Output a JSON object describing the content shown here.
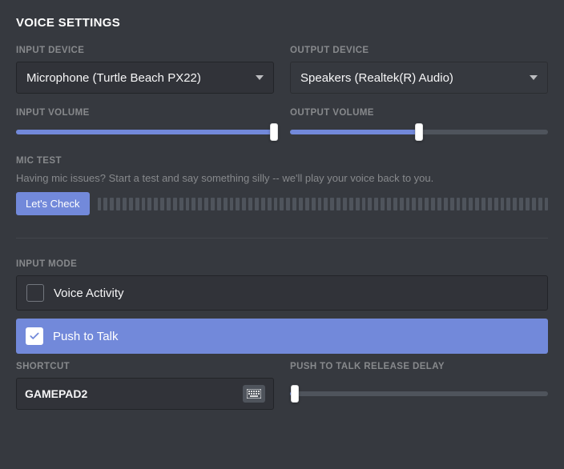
{
  "title": "VOICE SETTINGS",
  "input_device": {
    "label": "INPUT DEVICE",
    "value": "Microphone (Turtle Beach PX22)"
  },
  "output_device": {
    "label": "OUTPUT DEVICE",
    "value": "Speakers (Realtek(R) Audio)"
  },
  "input_volume": {
    "label": "INPUT VOLUME",
    "percent": 100
  },
  "output_volume": {
    "label": "OUTPUT VOLUME",
    "percent": 50
  },
  "mic_test": {
    "label": "MIC TEST",
    "help": "Having mic issues? Start a test and say something silly -- we'll play your voice back to you.",
    "button": "Let's Check"
  },
  "input_mode": {
    "label": "INPUT MODE",
    "options": [
      {
        "label": "Voice Activity",
        "selected": false
      },
      {
        "label": "Push to Talk",
        "selected": true
      }
    ]
  },
  "shortcut": {
    "label": "SHORTCUT",
    "value": "GAMEPAD2"
  },
  "ptt_delay": {
    "label": "PUSH TO TALK RELEASE DELAY",
    "percent": 2
  }
}
